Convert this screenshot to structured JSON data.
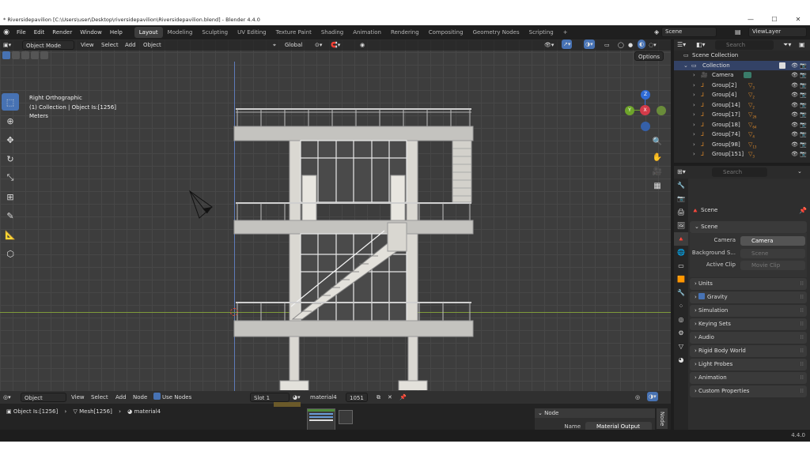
{
  "window": {
    "title": "* Riversidepavilion [C:\\Users\\user\\Desktop\\riversidepavilion\\Riversidepavilion.blend] - Blender 4.4.0",
    "minimize": "—",
    "maximize": "☐",
    "close": "✕"
  },
  "menu": [
    "File",
    "Edit",
    "Render",
    "Window",
    "Help"
  ],
  "workspaces": [
    "Layout",
    "Modeling",
    "Sculpting",
    "UV Editing",
    "Texture Paint",
    "Shading",
    "Animation",
    "Rendering",
    "Compositing",
    "Geometry Nodes",
    "Scripting"
  ],
  "add_workspace": "+",
  "scene_selector": "Scene",
  "viewlayer_selector": "ViewLayer",
  "viewport": {
    "mode": "Object Mode",
    "menus": [
      "View",
      "Select",
      "Add",
      "Object"
    ],
    "orientation": "Global",
    "options": "Options",
    "view_name": "Right Orthographic",
    "collection_info": "(1) Collection | Object Is:[1256]",
    "units": "Meters"
  },
  "gizmo": {
    "z": "Z",
    "y": "Y",
    "x": "X"
  },
  "outliner": {
    "search_placeholder": "Search",
    "root": "Scene Collection",
    "collection": "Collection",
    "items": [
      {
        "name": "Camera",
        "badge": ""
      },
      {
        "name": "Group[2]",
        "badge": "3"
      },
      {
        "name": "Group[4]",
        "badge": "2"
      },
      {
        "name": "Group[14]",
        "badge": "2"
      },
      {
        "name": "Group[17]",
        "badge": "26"
      },
      {
        "name": "Group[18]",
        "badge": "64"
      },
      {
        "name": "Group[74]",
        "badge": "4"
      },
      {
        "name": "Group[98]",
        "badge": "13"
      },
      {
        "name": "Group[151]",
        "badge": "3"
      }
    ]
  },
  "properties": {
    "search_placeholder": "Search",
    "context": "Scene",
    "scene_panel": "Scene",
    "camera_label": "Camera",
    "camera_value": "Camera",
    "background_label": "Background S...",
    "background_placeholder": "Scene",
    "clip_label": "Active Clip",
    "clip_placeholder": "Movie Clip",
    "panels": [
      "Units",
      "Gravity",
      "Simulation",
      "Keying Sets",
      "Audio",
      "Rigid Body World",
      "Light Probes",
      "Animation",
      "Custom Properties"
    ]
  },
  "node_editor": {
    "type": "Object",
    "menus": [
      "View",
      "Select",
      "Add",
      "Node"
    ],
    "use_nodes": "Use Nodes",
    "slot": "Slot 1",
    "material": "material4",
    "users": "1051",
    "breadcrumb": [
      "Object Is:[1256]",
      "Mesh[1256]",
      "material4"
    ],
    "n_panel_title": "Node",
    "name_label": "Name",
    "name_value": "Material Output",
    "sidebar_tab": "Node"
  },
  "status": {
    "version": "4.4.0"
  },
  "colors": {
    "accent": "#4772b3",
    "axis_x": "#d33b49",
    "axis_y": "#6ea42a",
    "axis_z": "#2f6bd5"
  }
}
